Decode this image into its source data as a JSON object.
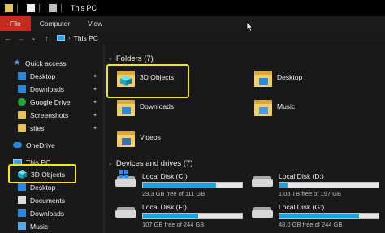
{
  "window": {
    "title": "This PC"
  },
  "ribbon": {
    "tabs": [
      "File",
      "Computer",
      "View"
    ]
  },
  "address": {
    "path": "This PC"
  },
  "sidebar": {
    "quick_access": "Quick access",
    "pinned": [
      "Desktop",
      "Downloads",
      "Google Drive",
      "Screenshots",
      "sites"
    ],
    "onedrive": "OneDrive",
    "this_pc": "This PC",
    "pc_children": [
      "3D Objects",
      "Desktop",
      "Documents",
      "Downloads",
      "Music"
    ]
  },
  "main": {
    "folders_header": "Folders (7)",
    "folders": [
      "3D Objects",
      "Desktop",
      "Downloads",
      "Music",
      "Videos"
    ],
    "drives_header": "Devices and drives (7)",
    "drives": [
      {
        "name": "Local Disk (C:)",
        "free": "29.3 GB free of 111 GB",
        "used_fraction": 0.74
      },
      {
        "name": "Local Disk (D:)",
        "free": "1.08 TB free of 197 GB",
        "used_fraction": 0.08
      },
      {
        "name": "Local Disk (F:)",
        "free": "107 GB free of 244 GB",
        "used_fraction": 0.56
      },
      {
        "name": "Local Disk (G:)",
        "free": "48.0 GB free of 244 GB",
        "used_fraction": 0.8
      }
    ]
  },
  "colors": {
    "highlight": "#f5e61a",
    "accent": "#26a0da",
    "file_tab": "#c42b1c"
  }
}
